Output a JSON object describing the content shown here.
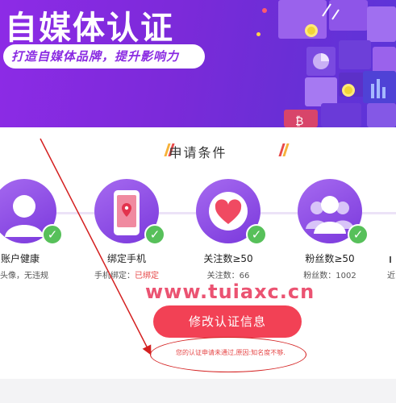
{
  "banner": {
    "title": "自媒体认证",
    "subtitle": "打造自媒体品牌，提升影响力"
  },
  "section": {
    "title": "申请条件"
  },
  "steps": [
    {
      "label": "账户健康",
      "detail": "清晰头像，无违规",
      "detail_em": ""
    },
    {
      "label": "绑定手机",
      "detail": "手机绑定：",
      "detail_em": "已绑定"
    },
    {
      "label": "关注数≥50",
      "detail": "关注数：66",
      "detail_em": ""
    },
    {
      "label": "粉丝数≥50",
      "detail": "粉丝数：1002",
      "detail_em": ""
    }
  ],
  "edge_partial": "近",
  "watermark": "www.tuiaxc.cn",
  "actions": {
    "modify_label": "修改认证信息"
  },
  "notice": "您的认证申请未通过,原因:知名度不够.",
  "colors": {
    "purple": "#7b2ad9",
    "accent_red": "#f24155",
    "check_green": "#57c05a",
    "annotation_red": "#d42020"
  }
}
